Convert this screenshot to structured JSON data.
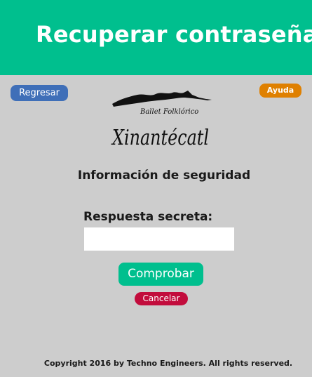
{
  "header": {
    "title": "Recuperar contraseña",
    "color": "#00bf8e"
  },
  "nav": {
    "back_label": "Regresar",
    "help_label": "Ayuda"
  },
  "logo": {
    "subtitle": "Ballet Folklórico",
    "name": "Xinantécatl"
  },
  "form": {
    "section_title": "Información de seguridad",
    "answer_label": "Respuesta secreta:",
    "answer_value": "",
    "submit_label": "Comprobar",
    "cancel_label": "Cancelar"
  },
  "footer": {
    "text": "Copyright 2016 by Techno Engineers. All rights reserved."
  },
  "colors": {
    "background": "#cdcdcd",
    "regresar": "#3f6fb8",
    "ayuda": "#df8000",
    "comprobar": "#00bf8e",
    "cancelar": "#c20c3c"
  }
}
